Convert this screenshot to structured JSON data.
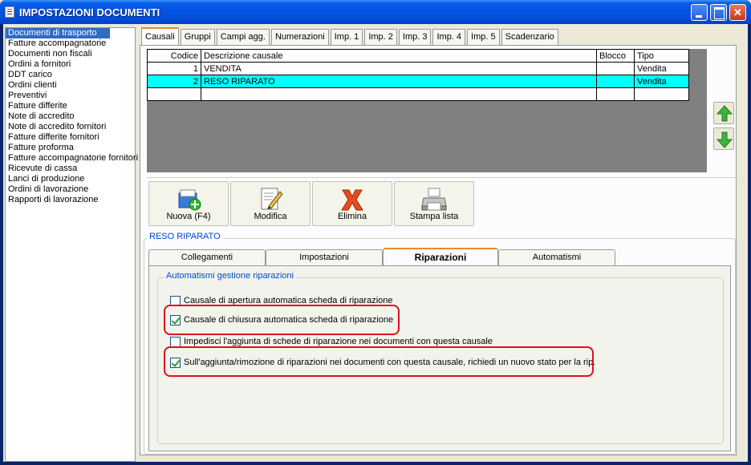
{
  "window": {
    "title": "IMPOSTAZIONI DOCUMENTI"
  },
  "sidebar": {
    "items": [
      "Documenti di trasporto",
      "Fatture accompagnatorie",
      "Documenti non fiscali",
      "Ordini a fornitori",
      "DDT carico",
      "Ordini clienti",
      "Preventivi",
      "Fatture differite",
      "Note di accredito",
      "Note di accredito fornitori",
      "Fatture differite fornitori",
      "Fatture proforma",
      "Fatture accompagnatorie fornitori",
      "Ricevute di cassa",
      "Lanci di produzione",
      "Ordini di lavorazione",
      "Rapporti di lavorazione"
    ],
    "selected": "Documenti di trasporto"
  },
  "tabs": [
    "Causali",
    "Gruppi",
    "Campi agg.",
    "Numerazioni",
    "Imp. 1",
    "Imp. 2",
    "Imp. 3",
    "Imp. 4",
    "Imp. 5",
    "Scadenzario"
  ],
  "grid": {
    "headers": [
      "Codice",
      "Descrizione causale",
      "Blocco",
      "Tipo"
    ],
    "rows": [
      [
        "1",
        "VENDITA",
        "",
        "Vendita"
      ],
      [
        "2",
        "RESO RIPARATO",
        "",
        "Vendita"
      ]
    ]
  },
  "buttons": {
    "nuova": "Nuova (F4)",
    "modifica": "Modifica",
    "elimina": "Elimina",
    "stampa": "Stampa lista"
  },
  "detail": {
    "title": "RESO RIPARATO",
    "subtabs": [
      "Collegamenti",
      "Impostazioni",
      "Riparazioni",
      "Automatismi"
    ],
    "group_title": "Automatismi gestione riparazioni",
    "checks": [
      {
        "label": "Causale di apertura automatica scheda di riparazione",
        "checked": false
      },
      {
        "label": "Causale di chiusura automatica scheda di riparazione",
        "checked": true
      },
      {
        "label": "Impedisci l'aggiunta di schede di riparazione nei documenti con questa causale",
        "checked": false
      },
      {
        "label": "Sull'aggiunta/rimozione di riparazioni nei documenti con questa causale, richiedi un nuovo stato per la rip.",
        "checked": true
      }
    ]
  },
  "colors": {
    "accent": "#316AC5",
    "selected_row": "#00FFFF",
    "highlight": "#E0101A",
    "group_title": "#0046D5"
  }
}
